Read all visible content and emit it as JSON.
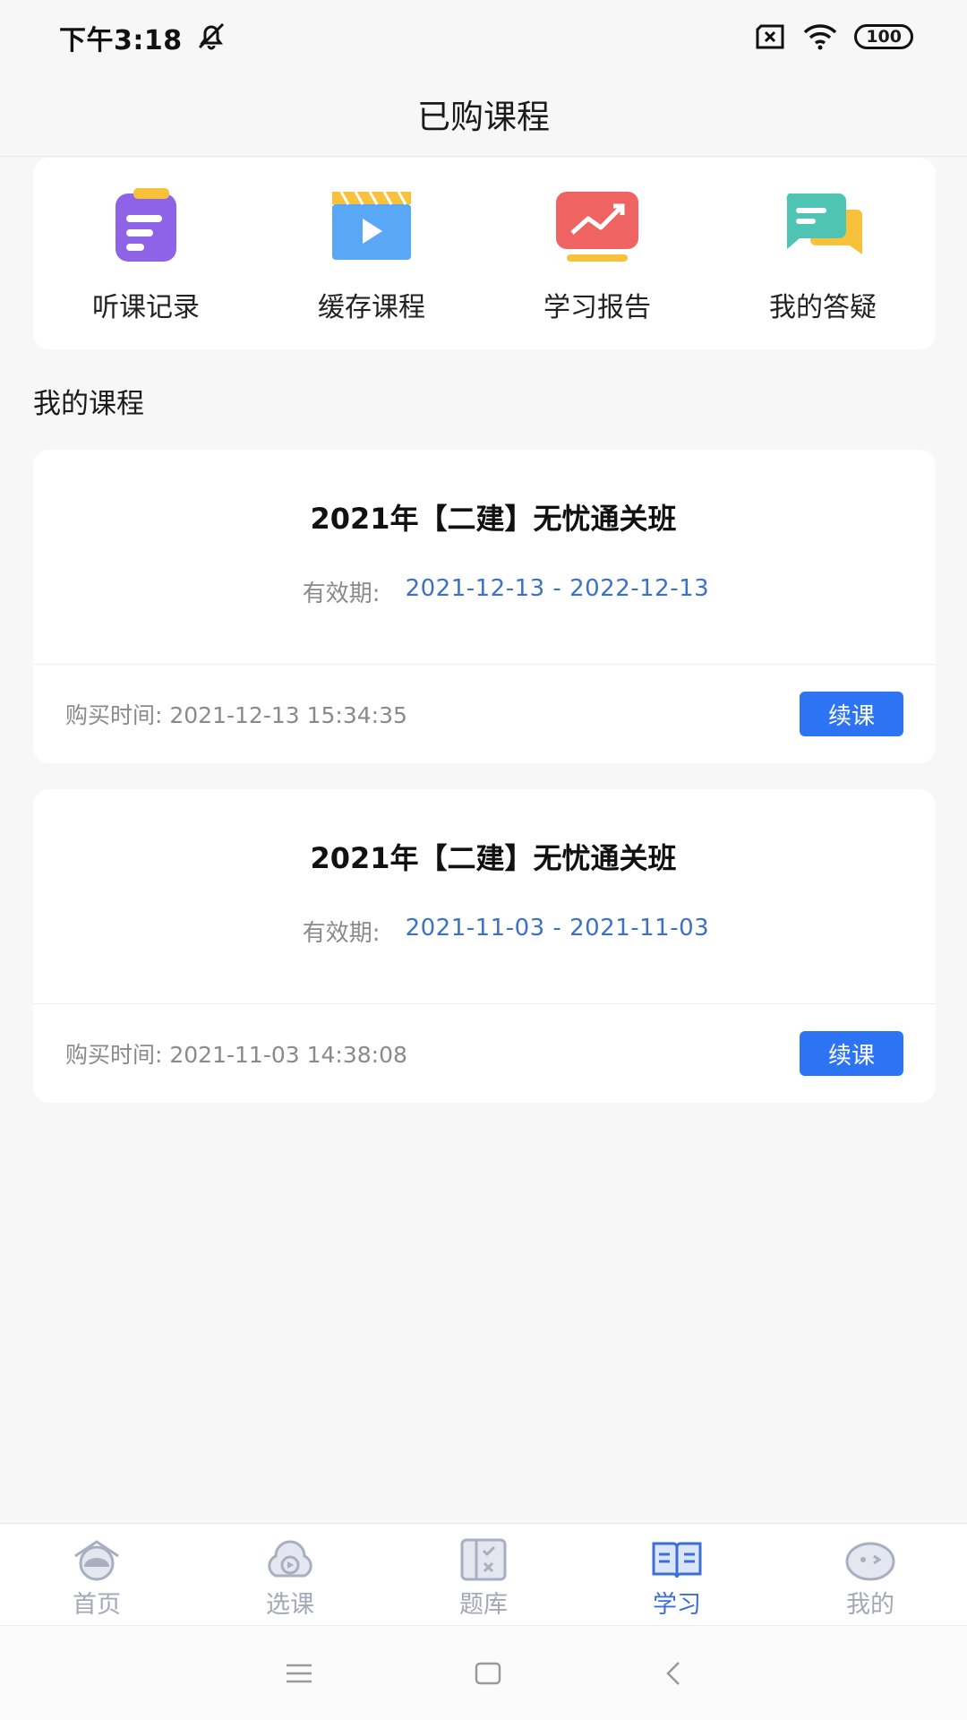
{
  "status_bar": {
    "time": "下午3:18",
    "battery": "100",
    "icons": [
      "mute-bell-icon",
      "sim-x-icon",
      "wifi-icon",
      "battery-icon"
    ]
  },
  "header": {
    "title": "已购课程"
  },
  "quick_menu": [
    {
      "label": "听课记录",
      "icon": "clipboard-icon",
      "color": "#8e63e8"
    },
    {
      "label": "缓存课程",
      "icon": "video-icon",
      "color": "#5aa8f5"
    },
    {
      "label": "学习报告",
      "icon": "chart-report-icon",
      "color": "#f06363"
    },
    {
      "label": "我的答疑",
      "icon": "chat-bubbles-icon",
      "color": "#4fc3b4"
    }
  ],
  "section_title": "我的课程",
  "courses": [
    {
      "title": "2021年【二建】无忧通关班",
      "validity_label": "有效期:",
      "validity": "2021-12-13 - 2022-12-13",
      "purchase": "购买时间: 2021-12-13 15:34:35",
      "button": "续课"
    },
    {
      "title": "2021年【二建】无忧通关班",
      "validity_label": "有效期:",
      "validity": "2021-11-03 - 2021-11-03",
      "purchase": "购买时间: 2021-11-03 14:38:08",
      "button": "续课"
    }
  ],
  "tabs": [
    {
      "label": "首页",
      "icon": "home-icon",
      "active": false
    },
    {
      "label": "选课",
      "icon": "play-cloud-icon",
      "active": false
    },
    {
      "label": "题库",
      "icon": "question-bank-icon",
      "active": false
    },
    {
      "label": "学习",
      "icon": "open-book-icon",
      "active": true
    },
    {
      "label": "我的",
      "icon": "profile-face-icon",
      "active": false
    }
  ],
  "colors": {
    "accent": "#2d74f4",
    "validity": "#3b72c7",
    "tab_active": "#3b6fd8",
    "tab_inactive": "#a3a8b8"
  },
  "system_nav": [
    "menu-icon",
    "home-square-icon",
    "back-icon"
  ]
}
